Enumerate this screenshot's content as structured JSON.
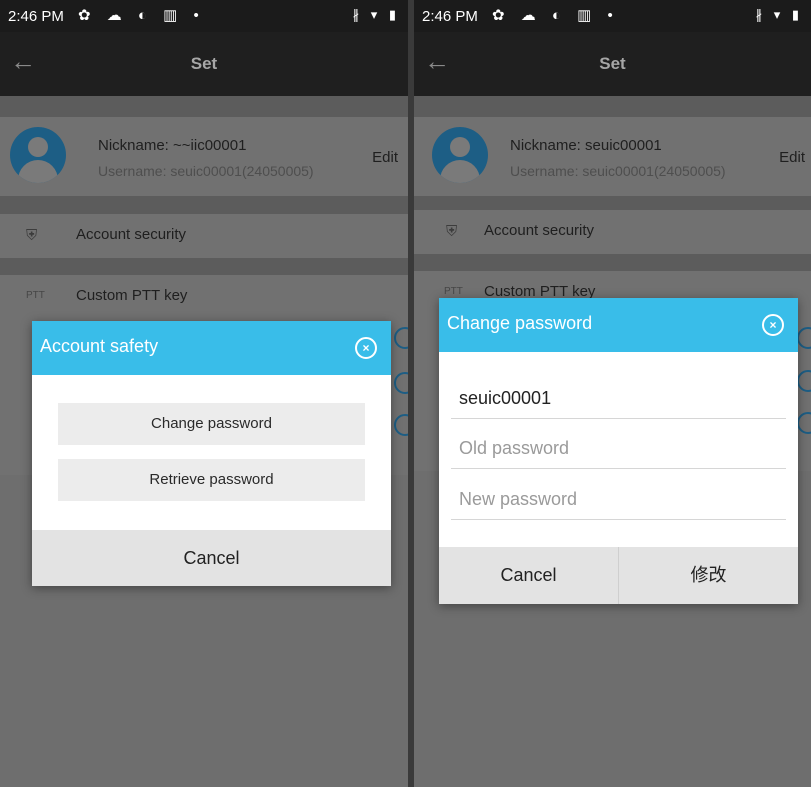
{
  "status_bar": {
    "time": "2:46 PM"
  },
  "app_bar": {
    "back_icon": "←",
    "title": "Set"
  },
  "profile": {
    "left_nickname": "Nickname: ~~iic00001",
    "right_nickname": "Nickname: seuic00001",
    "username": "Username: seuic00001(24050005)",
    "edit_label": "Edit"
  },
  "settings": {
    "account_security": "Account security",
    "ptt_badge": "PTT",
    "custom_ptt": "Custom PTT key"
  },
  "account_dialog": {
    "title": "Account safety",
    "change_password": "Change password",
    "retrieve_password": "Retrieve password",
    "cancel": "Cancel"
  },
  "password_dialog": {
    "title": "Change password",
    "username_value": "seuic00001",
    "old_password_placeholder": "Old password",
    "new_password_placeholder": "New password",
    "cancel": "Cancel",
    "confirm": "修改"
  },
  "colors": {
    "dialog_header": "#39bde9",
    "avatar": "#1d5e85",
    "status_bar": "#1b1b1b"
  }
}
